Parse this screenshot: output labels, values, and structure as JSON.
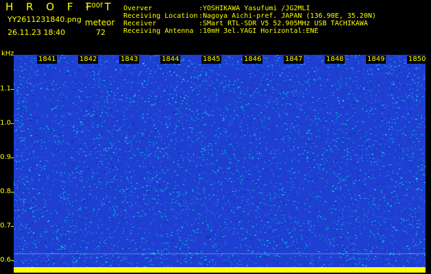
{
  "header": {
    "app_title": "H R O F F T",
    "version": "1.00f",
    "filename": "YY2611231840.png",
    "mode": "meteor",
    "datetime": "26.11.23 18:40",
    "count": "72"
  },
  "station_info": [
    {
      "label": "Overver",
      "value": ":YOSHIKAWA Yasufumi /JG2MLI"
    },
    {
      "label": "Receiving Location",
      "value": ":Nagoya Aichi-pref. JAPAN (136.90E, 35.20N)"
    },
    {
      "label": "Receiver",
      "value": ":SMart RTL-SDR V5 52.905MHz USB TACHIKAWA"
    },
    {
      "label": "Receiving Antenna",
      "value": ":10mH 3el.YAGI Horizontal:ENE"
    }
  ],
  "spectrogram": {
    "y_unit": "kHz",
    "time_labels": [
      "1841",
      "1842",
      "1843",
      "1844",
      "1845",
      "1846",
      "1847",
      "1848",
      "1849",
      "1850"
    ],
    "freq_ticks": [
      "1.1",
      "1.0",
      "0.9",
      "0.8",
      "0.7",
      "0.6"
    ],
    "freq_range_khz": [
      0.58,
      1.19
    ],
    "colors": {
      "background": "#1e3fd2",
      "noise_low": "#2448e6",
      "noise_high": "#00ffff",
      "text": "#ffff00"
    }
  }
}
